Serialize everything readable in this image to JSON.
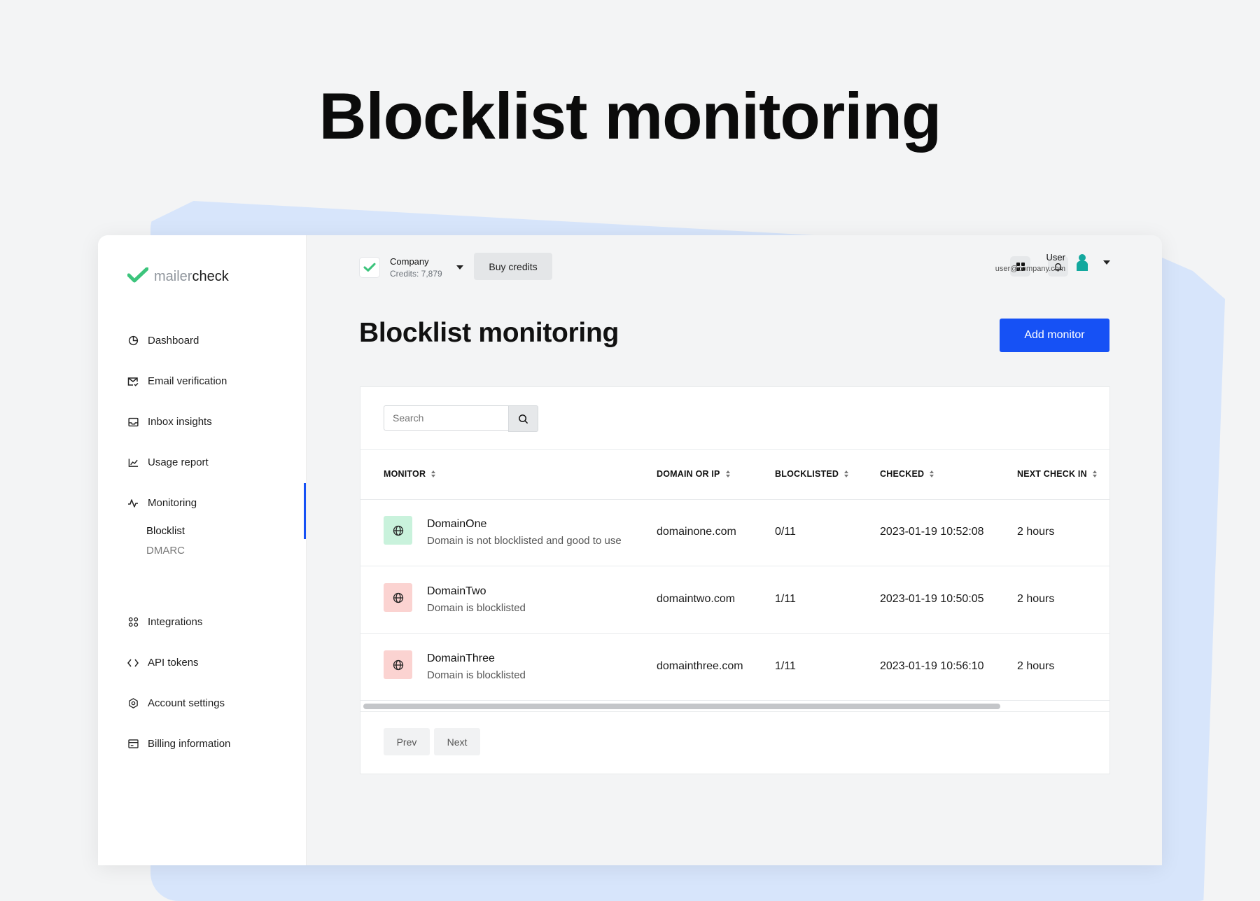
{
  "hero": {
    "title": "Blocklist monitoring"
  },
  "colors": {
    "accent": "#1651f5",
    "success_bg": "#c9f2dc",
    "danger_bg": "#fbd3d1",
    "logo_green": "#3cc47c"
  },
  "sidebar": {
    "logo": {
      "light": "mailer",
      "bold": "check"
    },
    "items": [
      {
        "label": "Dashboard",
        "icon": "chart-pie-icon"
      },
      {
        "label": "Email verification",
        "icon": "mail-check-icon"
      },
      {
        "label": "Inbox insights",
        "icon": "inbox-icon"
      },
      {
        "label": "Usage report",
        "icon": "line-chart-icon"
      },
      {
        "label": "Monitoring",
        "icon": "activity-icon"
      }
    ],
    "sub_items": [
      {
        "label": "Blocklist"
      },
      {
        "label": "DMARC"
      }
    ],
    "bottom_items": [
      {
        "label": "Integrations",
        "icon": "integrations-icon"
      },
      {
        "label": "API tokens",
        "icon": "code-icon"
      },
      {
        "label": "Account settings",
        "icon": "settings-icon"
      },
      {
        "label": "Billing information",
        "icon": "billing-icon"
      }
    ]
  },
  "topbar": {
    "company_name": "Company",
    "credits": "Credits: 7,879",
    "buy_credits": "Buy credits",
    "user_name": "User",
    "user_email": "user@company.com"
  },
  "main": {
    "title": "Blocklist monitoring",
    "add_button": "Add monitor"
  },
  "search": {
    "placeholder": "Search"
  },
  "table": {
    "headers": [
      "MONITOR",
      "DOMAIN OR IP",
      "BLOCKLISTED",
      "CHECKED",
      "NEXT CHECK IN"
    ],
    "rows": [
      {
        "name": "DomainOne",
        "desc": "Domain is not blocklisted and good to use",
        "status": "ok",
        "domain": "domainone.com",
        "blocklisted": "0/11",
        "checked": "2023-01-19 10:52:08",
        "next": "2 hours"
      },
      {
        "name": "DomainTwo",
        "desc": "Domain is blocklisted",
        "status": "listed",
        "domain": "domaintwo.com",
        "blocklisted": "1/11",
        "checked": "2023-01-19 10:50:05",
        "next": "2 hours"
      },
      {
        "name": "DomainThree",
        "desc": "Domain is blocklisted",
        "status": "listed",
        "domain": "domainthree.com",
        "blocklisted": "1/11",
        "checked": "2023-01-19 10:56:10",
        "next": "2 hours"
      }
    ]
  },
  "pagination": {
    "prev": "Prev",
    "next": "Next"
  }
}
